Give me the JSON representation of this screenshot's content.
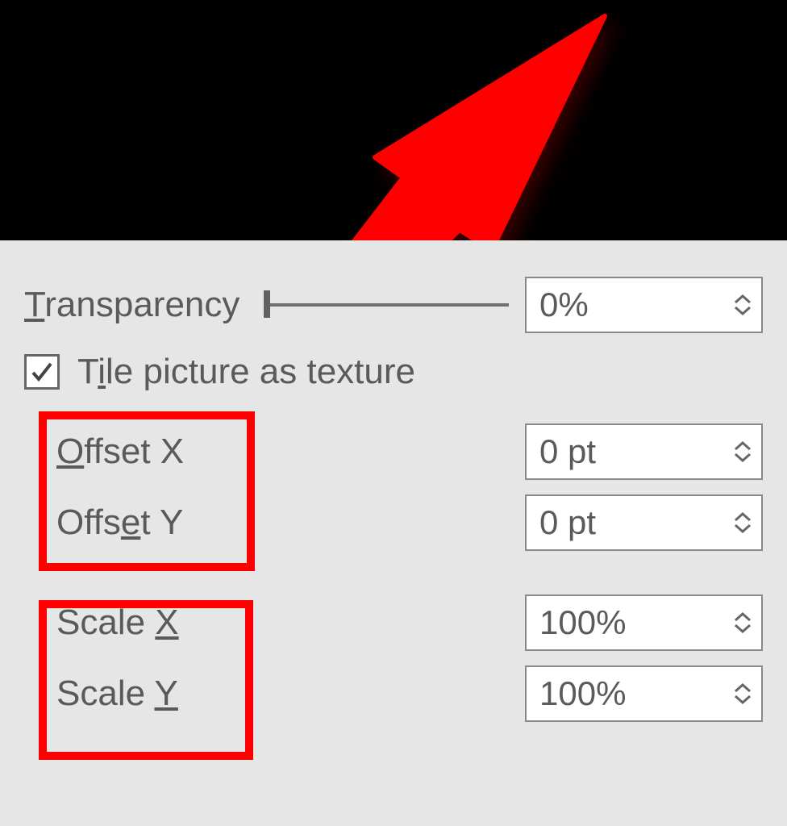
{
  "transparency": {
    "label": "Transparency",
    "label_hotkey_char": "T",
    "value": "0%"
  },
  "tile": {
    "label": "Tile picture as texture",
    "label_hotkey_char": "I",
    "checked": true
  },
  "fields": {
    "offset_x": {
      "label": "Offset X",
      "hotkey": "O",
      "value": "0 pt"
    },
    "offset_y": {
      "label": "Offset Y",
      "hotkey": "e",
      "value": "0 pt"
    },
    "scale_x": {
      "label": "Scale X",
      "hotkey": "X",
      "value": "100%"
    },
    "scale_y": {
      "label": "Scale Y",
      "hotkey": "Y",
      "value": "100%"
    }
  },
  "annotations": {
    "arrow_color": "#ff0000",
    "highlight_color": "#ff0000"
  }
}
